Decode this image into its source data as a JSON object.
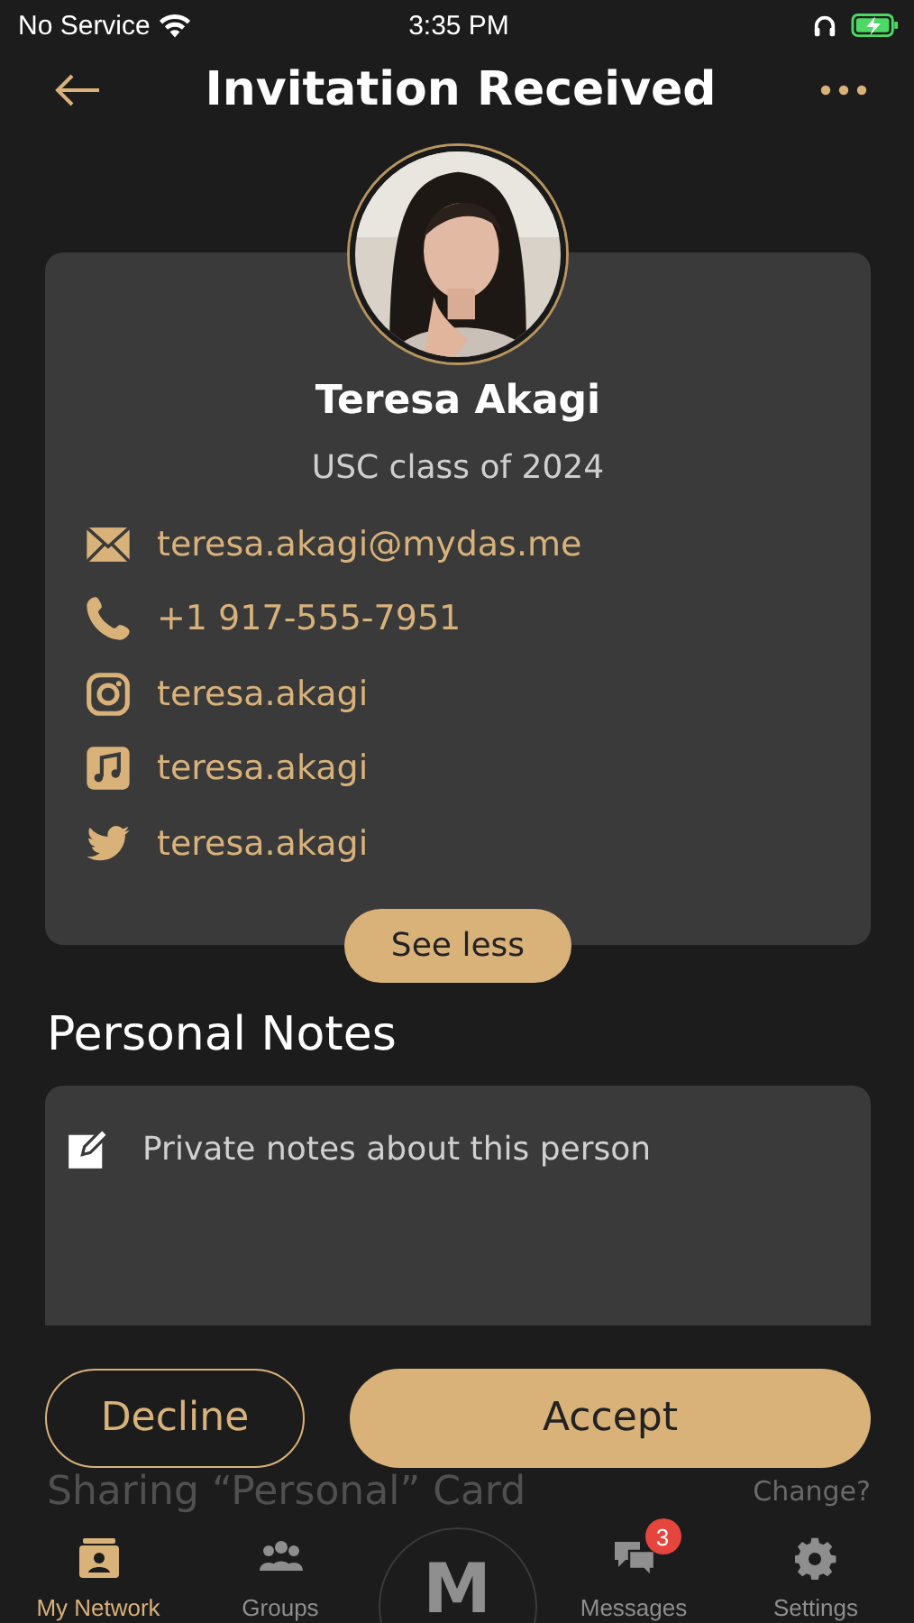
{
  "status_bar": {
    "carrier": "No Service",
    "time": "3:35 PM",
    "charging": true
  },
  "header": {
    "title": "Invitation Received"
  },
  "profile": {
    "name": "Teresa Akagi",
    "subtitle": "USC class of 2024",
    "contacts": [
      {
        "kind": "email",
        "value": "teresa.akagi@mydas.me"
      },
      {
        "kind": "phone",
        "value": "+1 917-555-7951"
      },
      {
        "kind": "instagram",
        "value": "teresa.akagi"
      },
      {
        "kind": "music",
        "value": "teresa.akagi"
      },
      {
        "kind": "twitter",
        "value": "teresa.akagi"
      }
    ],
    "toggle_button": "See less"
  },
  "notes": {
    "heading": "Personal Notes",
    "placeholder": "Private notes about this person"
  },
  "actions": {
    "decline": "Decline",
    "accept": "Accept"
  },
  "sharing": {
    "label": "Sharing “Personal” Card",
    "link": "Change?"
  },
  "tab_bar": {
    "logo": "M",
    "tabs": [
      {
        "kind": "network",
        "label": "My Network",
        "selected": true
      },
      {
        "kind": "groups",
        "label": "Groups",
        "selected": false
      },
      {
        "kind": "center"
      },
      {
        "kind": "messages",
        "label": "Messages",
        "selected": false,
        "badge": "3"
      },
      {
        "kind": "settings",
        "label": "Settings",
        "selected": false
      }
    ]
  }
}
